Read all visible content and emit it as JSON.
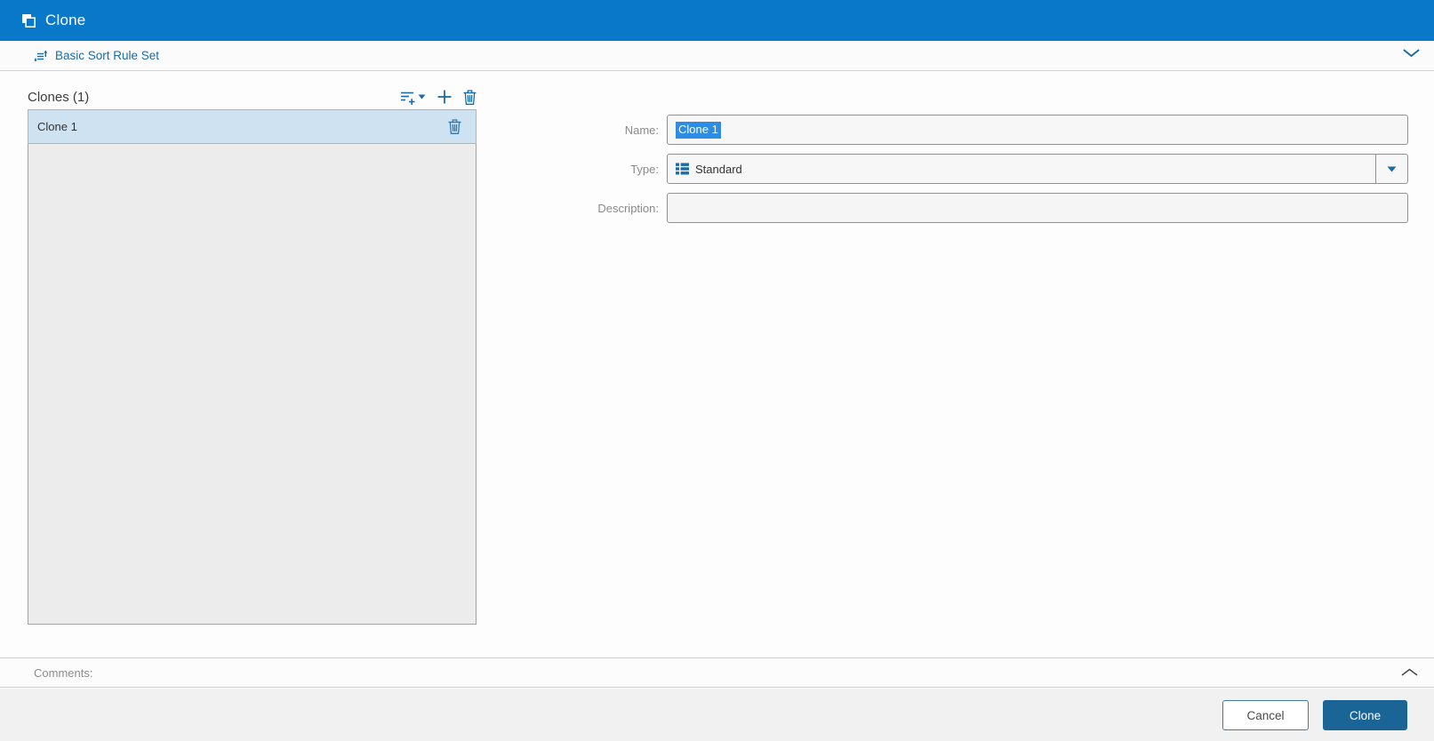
{
  "titlebar": {
    "title": "Clone"
  },
  "breadcrumb": {
    "label": "Basic Sort Rule Set"
  },
  "clones_panel": {
    "header": "Clones (1)",
    "items": [
      {
        "label": "Clone 1",
        "selected": true
      }
    ],
    "toolbar_icons": [
      "sort-add-icon",
      "caret-down-icon",
      "add-icon",
      "delete-icon"
    ]
  },
  "form": {
    "name": {
      "label": "Name:",
      "value": "Clone 1",
      "text_selected": true
    },
    "type": {
      "label": "Type:",
      "value": "Standard",
      "icon": "type-list-icon"
    },
    "description": {
      "label": "Description:",
      "value": ""
    }
  },
  "comments": {
    "label": "Comments:"
  },
  "footer": {
    "cancel_label": "Cancel",
    "clone_label": "Clone"
  },
  "colors": {
    "titlebar_bg": "#0a78c8",
    "accent_icon_blue": "#1a6ca8",
    "breadcrumb_link": "#1b6ba3",
    "text_selection_bg": "#2f8ce4",
    "selected_item_bg": "#cfe2f1",
    "list_bg": "#ececec",
    "primary_button_bg": "#1a6496",
    "footer_bg": "#f1f1f1"
  }
}
